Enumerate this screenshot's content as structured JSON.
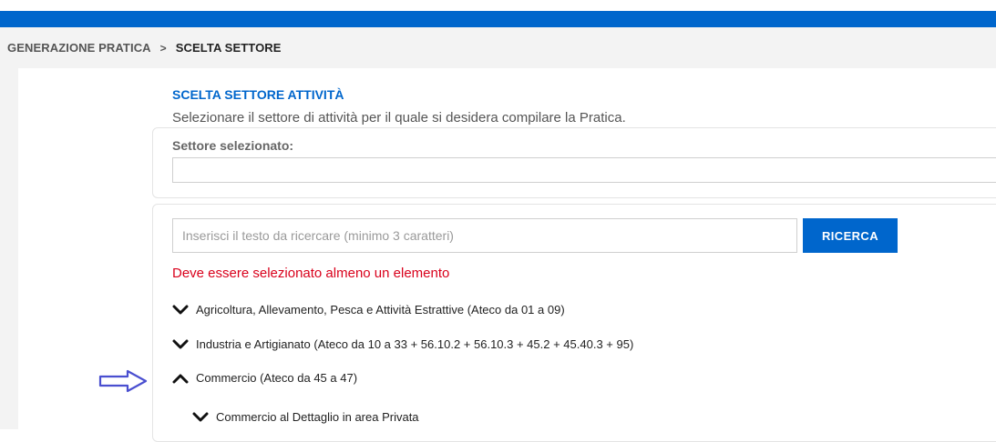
{
  "breadcrumb": {
    "items": [
      "GENERAZIONE PRATICA",
      "SCELTA SETTORE"
    ],
    "separator": ">"
  },
  "page": {
    "title": "SCELTA SETTORE ATTIVITÀ",
    "subtitle": "Selezionare il settore di attività per il quale si desidera compilare la Pratica."
  },
  "selected_sector": {
    "label": "Settore selezionato:",
    "value": ""
  },
  "search": {
    "placeholder": "Inserisci il testo da ricercare (minimo 3 caratteri)",
    "value": "",
    "button_label": "RICERCA"
  },
  "validation": {
    "error_message": "Deve essere selezionato almeno un elemento"
  },
  "tree": {
    "items": [
      {
        "label": "Agricoltura, Allevamento, Pesca e Attività Estrattive (Ateco da 01 a 09)",
        "state": "collapsed",
        "icon": "chevron-down-icon"
      },
      {
        "label": "Industria e Artigianato (Ateco da 10 a 33 + 56.10.2 + 56.10.3 + 45.2 + 45.40.3 + 95)",
        "state": "collapsed",
        "icon": "chevron-down-icon"
      },
      {
        "label": "Commercio (Ateco da 45 a 47)",
        "state": "expanded",
        "icon": "chevron-up-icon"
      },
      {
        "label": "Commercio al Dettaglio in area Privata",
        "state": "collapsed",
        "icon": "chevron-down-icon",
        "level": 1
      }
    ]
  },
  "annotation": {
    "icon": "right-arrow-outline-icon",
    "color": "#4a4fd0"
  },
  "colors": {
    "accent": "#0066cc",
    "error": "#d9001b",
    "breadcrumb_bg": "#f3f3f3"
  }
}
